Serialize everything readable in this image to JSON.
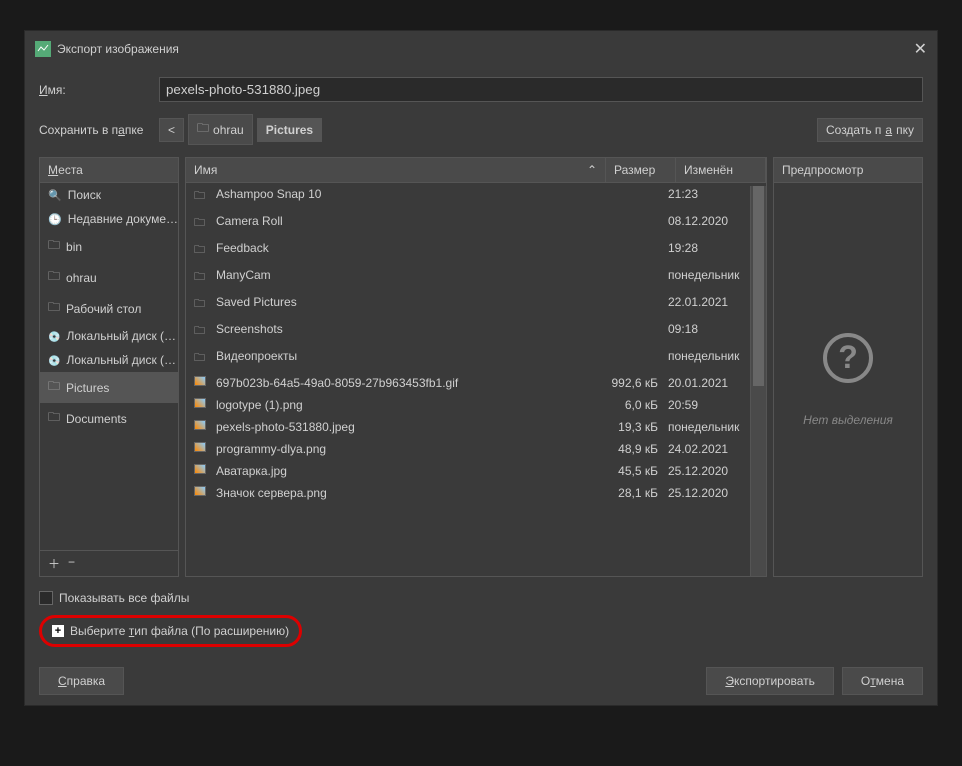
{
  "title": "Экспорт изображения",
  "nameLabel": "Имя:",
  "filename": "pexels-photo-531880.jpeg",
  "saveInFolder": "Сохранить в папке",
  "bcBack": "<",
  "bcOhrau": "ohrau",
  "bcPictures": "Pictures",
  "createFolder": "Создать папку",
  "placesHdr": "Места",
  "places": [
    {
      "label": "Поиск",
      "icon": "search"
    },
    {
      "label": "Недавние докуме…",
      "icon": "recent"
    },
    {
      "label": "bin",
      "icon": "folder"
    },
    {
      "label": "ohrau",
      "icon": "folder"
    },
    {
      "label": "Рабочий стол",
      "icon": "folder"
    },
    {
      "label": "Локальный диск (…",
      "icon": "drive"
    },
    {
      "label": "Локальный диск (…",
      "icon": "drive"
    },
    {
      "label": "Pictures",
      "icon": "folder",
      "selected": true
    },
    {
      "label": "Documents",
      "icon": "folder"
    }
  ],
  "cols": {
    "name": "Имя",
    "size": "Размер",
    "mod": "Изменён"
  },
  "files": [
    {
      "icon": "folder",
      "name": "Ashampoo Snap 10",
      "size": "",
      "mod": "21:23"
    },
    {
      "icon": "folder",
      "name": "Camera Roll",
      "size": "",
      "mod": "08.12.2020"
    },
    {
      "icon": "folder",
      "name": "Feedback",
      "size": "",
      "mod": "19:28"
    },
    {
      "icon": "folder",
      "name": "ManyCam",
      "size": "",
      "mod": "понедельник"
    },
    {
      "icon": "folder",
      "name": "Saved Pictures",
      "size": "",
      "mod": "22.01.2021"
    },
    {
      "icon": "folder",
      "name": "Screenshots",
      "size": "",
      "mod": "09:18"
    },
    {
      "icon": "folder",
      "name": "Видеопроекты",
      "size": "",
      "mod": "понедельник"
    },
    {
      "icon": "img",
      "name": "697b023b-64a5-49a0-8059-27b963453fb1.gif",
      "size": "992,6 кБ",
      "mod": "20.01.2021"
    },
    {
      "icon": "img",
      "name": "logotype (1).png",
      "size": "6,0 кБ",
      "mod": "20:59"
    },
    {
      "icon": "img",
      "name": "pexels-photo-531880.jpeg",
      "size": "19,3 кБ",
      "mod": "понедельник"
    },
    {
      "icon": "img",
      "name": "programmy-dlya.png",
      "size": "48,9 кБ",
      "mod": "24.02.2021"
    },
    {
      "icon": "img",
      "name": "Аватарка.jpg",
      "size": "45,5 кБ",
      "mod": "25.12.2020"
    },
    {
      "icon": "img",
      "name": "Значок сервера.png",
      "size": "28,1 кБ",
      "mod": "25.12.2020"
    }
  ],
  "previewHdr": "Предпросмотр",
  "previewText": "Нет выделения",
  "showAll": "Показывать все файлы",
  "fileType": "Выберите тип файла (По расширению)",
  "help": "Справка",
  "export": "Экспортировать",
  "cancel": "Отмена"
}
